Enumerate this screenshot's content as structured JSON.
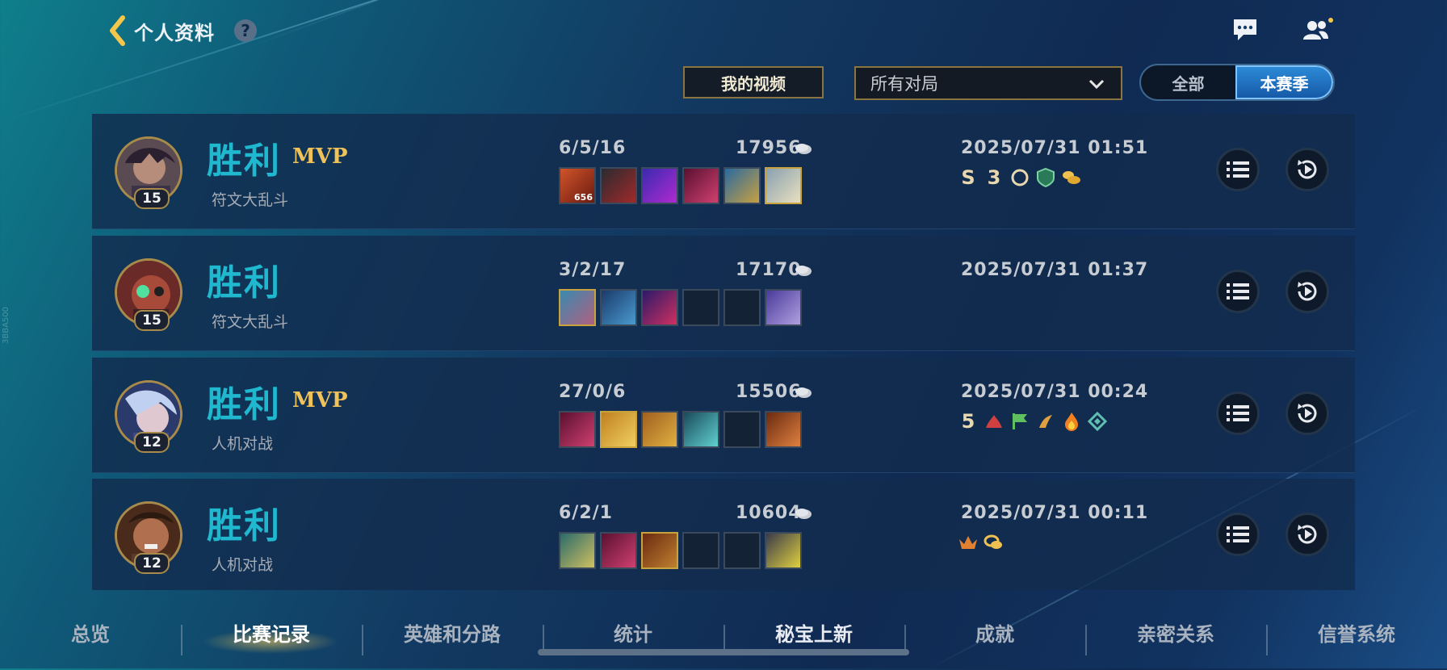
{
  "header": {
    "title": "个人资料",
    "help": "?"
  },
  "filters": {
    "my_video": "我的视频",
    "match_filter": "所有对局",
    "toggle": [
      "全部",
      "本赛季"
    ]
  },
  "matches": [
    {
      "result": "胜利",
      "mvp": "MVP",
      "mode": "符文大乱斗",
      "level": "15",
      "kda": "6/5/16",
      "gold": "17956",
      "datetime": "2025/07/31 01:51",
      "item_overlay": "656"
    },
    {
      "result": "胜利",
      "mvp": "",
      "mode": "符文大乱斗",
      "level": "15",
      "kda": "3/2/17",
      "gold": "17170",
      "datetime": "2025/07/31 01:37"
    },
    {
      "result": "胜利",
      "mvp": "MVP",
      "mode": "人机对战",
      "level": "12",
      "kda": "27/0/6",
      "gold": "15506",
      "datetime": "2025/07/31 00:24"
    },
    {
      "result": "胜利",
      "mvp": "",
      "mode": "人机对战",
      "level": "12",
      "kda": "6/2/1",
      "gold": "10604",
      "datetime": "2025/07/31 00:11"
    }
  ],
  "badges": {
    "row1": [
      "S",
      "3"
    ],
    "row3": [
      "5"
    ]
  },
  "nav": [
    "总览",
    "比赛记录",
    "英雄和分路",
    "统计",
    "秘宝上新",
    "成就",
    "亲密关系",
    "信誉系统"
  ],
  "side_code": "3BBA500",
  "colors": {
    "win": "#1fb8cf",
    "mvp": "#f0c25a",
    "frame_gold": "#8a7440",
    "toggle_active": "#1f73c4"
  },
  "icons": [
    "back-arrow-icon",
    "help-icon",
    "chat-icon",
    "friends-icon",
    "chevron-down-icon",
    "coin-icon",
    "list-icon",
    "replay-icon"
  ]
}
